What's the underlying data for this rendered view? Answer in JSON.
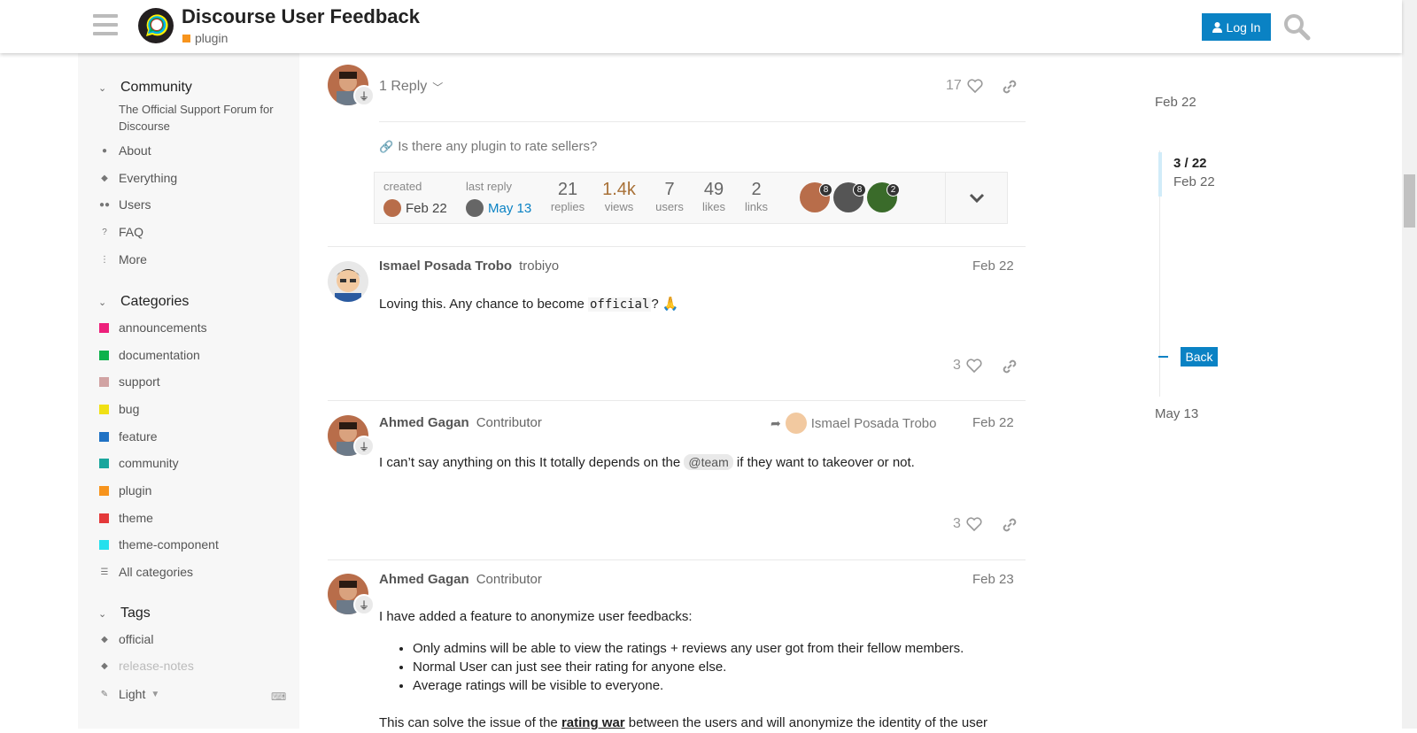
{
  "header": {
    "title": "Discourse User Feedback",
    "category": "plugin",
    "category_color": "#F7941D",
    "login_label": "Log In",
    "brand_color": "#0a82c4"
  },
  "sidebar": {
    "community_label": "Community",
    "community_desc": "The Official Support Forum for Discourse",
    "links": [
      {
        "label": "About",
        "icon": "info-icon"
      },
      {
        "label": "Everything",
        "icon": "layers-icon"
      },
      {
        "label": "Users",
        "icon": "users-icon"
      },
      {
        "label": "FAQ",
        "icon": "question-icon"
      },
      {
        "label": "More",
        "icon": "ellipsis-vertical-icon"
      }
    ],
    "categories_label": "Categories",
    "categories": [
      {
        "label": "announcements",
        "color": "#E45735"
      },
      {
        "label": "documentation",
        "color": "#12A89D"
      },
      {
        "label": "support",
        "color": "#D1A3A3"
      },
      {
        "label": "bug",
        "color": "#F0E015"
      },
      {
        "label": "feature",
        "color": "#1F72C4"
      },
      {
        "label": "community",
        "color": "#1AA69D"
      },
      {
        "label": "plugin",
        "color": "#F7941D"
      },
      {
        "label": "theme",
        "color": "#E4393A"
      },
      {
        "label": "theme-component",
        "color": "#24E0ED"
      }
    ],
    "all_categories": "All categories",
    "tags_label": "Tags",
    "tags": [
      "official",
      "release-notes"
    ],
    "theme_label": "Light"
  },
  "first_post": {
    "reply_label": "1 Reply",
    "likes": "17",
    "linked_topic": "Is there any plugin to rate sellers?"
  },
  "topic_map": {
    "created_label": "created",
    "created_date": "Feb 22",
    "last_reply_label": "last reply",
    "last_reply_date": "May 13",
    "stats": [
      {
        "num": "21",
        "label": "replies"
      },
      {
        "num": "1.4k",
        "label": "views"
      },
      {
        "num": "7",
        "label": "users"
      },
      {
        "num": "49",
        "label": "likes"
      },
      {
        "num": "2",
        "label": "links"
      }
    ],
    "participant_counts": [
      "8",
      "8",
      "2"
    ]
  },
  "posts": [
    {
      "author": "Ismael Posada Trobo",
      "username": "trobiyo",
      "date": "Feb 22",
      "body_pre": "Loving this. Any chance to become ",
      "body_code": "official",
      "body_post": "? 🙏",
      "likes": "3"
    },
    {
      "author": "Ahmed Gagan",
      "title": "Contributor",
      "reply_to": "Ismael Posada Trobo",
      "date": "Feb 22",
      "body_pre": "I can’t say anything on this It totally depends on the ",
      "mention": "@team",
      "body_post": " if they want to takeover or not.",
      "likes": "3"
    },
    {
      "author": "Ahmed Gagan",
      "title": "Contributor",
      "date": "Feb 23",
      "intro": "I have added a feature to anonymize user feedbacks:",
      "bullets": [
        "Only admins will be able to view the ratings + reviews any user got from their fellow members.",
        "Normal User can just see their rating for anyone else.",
        "Average ratings will be visible to everyone."
      ],
      "outro_pre": "This can solve the issue of the ",
      "outro_bold": "rating war",
      "outro_post": " between the users and will anonymize the identity of the user"
    }
  ],
  "timeline": {
    "start_date": "Feb 22",
    "position": "3 / 22",
    "position_date": "Feb 22",
    "back_label": "Back",
    "end_date": "May 13"
  }
}
